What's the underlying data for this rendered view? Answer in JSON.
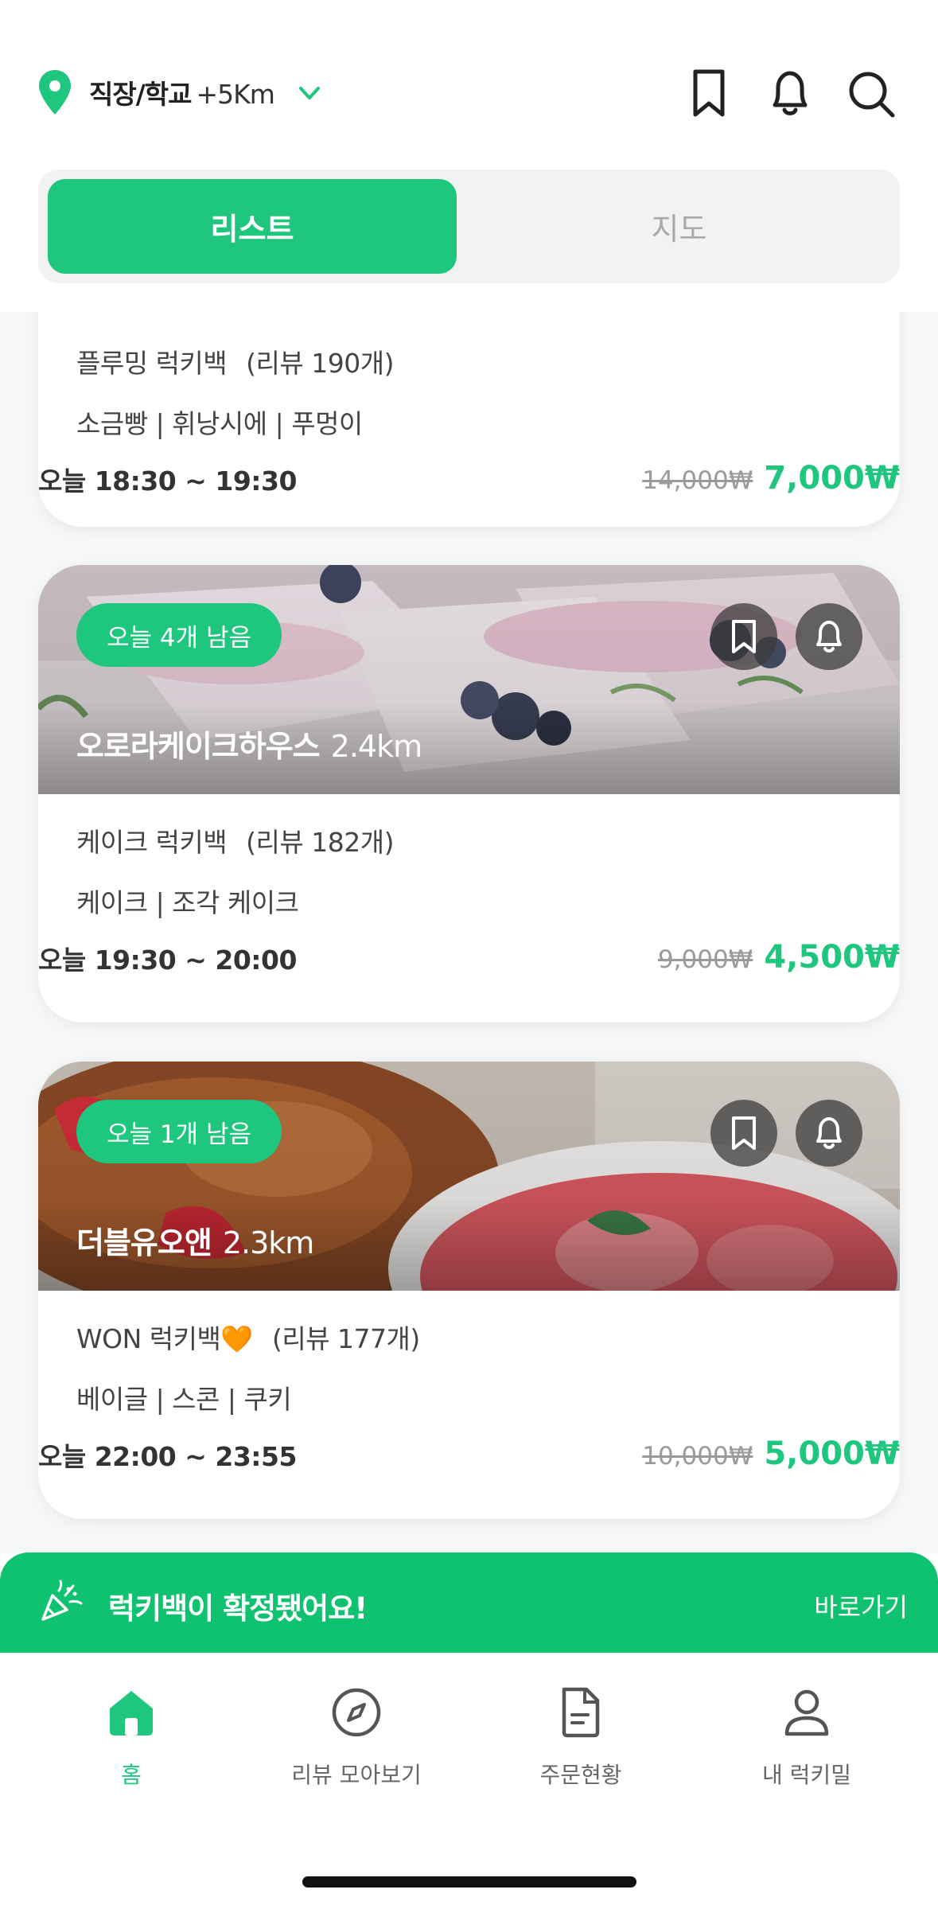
{
  "header": {
    "location_label": "직장/학교",
    "location_distance": "+5Km"
  },
  "tabs": [
    {
      "label": "리스트",
      "active": true
    },
    {
      "label": "지도",
      "active": false
    }
  ],
  "cards": [
    {
      "product": "플루밍 럭키백",
      "reviews": "(리뷰 190개)",
      "items": "소금빵 | 휘낭시에 | 푸멍이",
      "time": "오늘 18:30 ~ 19:30",
      "original_price": "14,000₩",
      "sale_price": "7,000₩"
    },
    {
      "badge": "오늘 4개 남음",
      "store": "오로라케이크하우스",
      "distance": "2.4km",
      "product": "케이크 럭키백",
      "reviews": "(리뷰 182개)",
      "items": "케이크 | 조각 케이크",
      "time": "오늘 19:30 ~ 20:00",
      "original_price": "9,000₩",
      "sale_price": "4,500₩"
    },
    {
      "badge": "오늘 1개 남음",
      "store": "더블유오앤",
      "distance": "2.3km",
      "product": "WON 럭키백🧡",
      "reviews": "(리뷰 177개)",
      "items": "베이글 | 스콘 | 쿠키",
      "time": "오늘 22:00 ~ 23:55",
      "original_price": "10,000₩",
      "sale_price": "5,000₩"
    }
  ],
  "banner": {
    "message": "럭키백이 확정됐어요!",
    "link": "바로가기"
  },
  "nav": [
    {
      "label": "홈",
      "icon": "home-icon",
      "active": true
    },
    {
      "label": "리뷰 모아보기",
      "icon": "compass-icon",
      "active": false
    },
    {
      "label": "주문현황",
      "icon": "document-icon",
      "active": false
    },
    {
      "label": "내 럭키밀",
      "icon": "person-icon",
      "active": false
    }
  ],
  "colors": {
    "accent": "#1ec77d",
    "banner": "#0fc26f"
  }
}
